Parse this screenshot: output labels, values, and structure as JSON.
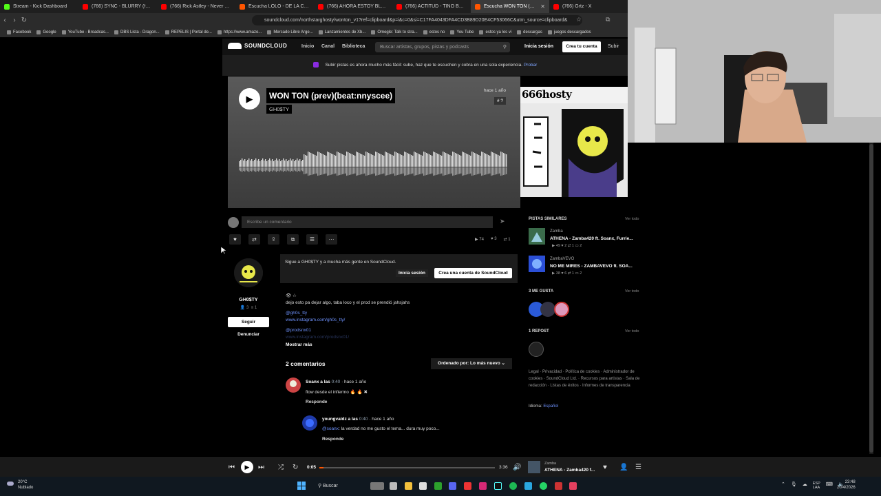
{
  "browser": {
    "tabs": [
      {
        "label": "Stream - Kick Dashboard",
        "color": "#53fc18"
      },
      {
        "label": "(766) SYNC - BLURRY (feat Duki) - Yo",
        "color": "#ff0000"
      },
      {
        "label": "(766) Rick Astley - Never Gonna Give",
        "color": "#ff0000"
      },
      {
        "label": "Escucha LOLO - DE LA CAMA AL CU",
        "color": "#ff5500"
      },
      {
        "label": "(766) AHORA ESTOY BLESS - YouTub",
        "color": "#ff0000"
      },
      {
        "label": "(766) ACTITUD - TINO BG - YouTube",
        "color": "#ff0000"
      },
      {
        "label": "Escucha WON TON (prev)(beat:n",
        "color": "#ff5500"
      },
      {
        "label": "(766) Grtz - X ",
        "color": "#ff0000"
      }
    ],
    "url": "soundcloud.com/northstarghosty/wonton_v1?ref=clipboard&p=i&c=0&si=C17FA4043DFA4CD3B89D20E4CF53066C&utm_source=clipboard&",
    "bookmarks": [
      "Facebook",
      "Google",
      "YouTube - Broadcas...",
      "DBS Lista - Dragon...",
      "REPELIS | Portal de...",
      "https://www.amazo...",
      "Mercado Libre Arge...",
      "Lanzamientos de Xb...",
      "Omegle: Talk to stra...",
      "estos no",
      "You Tube",
      "estos ya los vi",
      "descargas",
      "juegos descargados"
    ]
  },
  "header": {
    "logo": "SOUNDCLOUD",
    "nav": [
      "Inicio",
      "Canal",
      "Biblioteca"
    ],
    "search_placeholder": "Buscar artistas, grupos, pistas y podcasts",
    "login": "Inicia sesión",
    "signup": "Crea tu cuenta",
    "upload": "Subir"
  },
  "banner": {
    "text": "Subir pistas es ahora mucho más fácil: sube, haz que te escuchen y cobra en una sola experiencia.",
    "link": "Probar"
  },
  "track": {
    "title": "WON TON (prev)(beat:nnyscee)",
    "artist": "GH0$TY",
    "posted": "hace 1 año",
    "tag": "# ?",
    "artwork_text": "666hosty"
  },
  "comment_input": {
    "placeholder": "Escribe un comentario"
  },
  "stats": {
    "plays": "74",
    "likes": "3",
    "reposts": "1"
  },
  "artist_panel": {
    "name": "GH0$TY",
    "followers": "3",
    "tracks": "1",
    "follow": "Seguir",
    "report": "Denunciar"
  },
  "follow_card": {
    "text": "Sigue a GH0$TY y a mucha más gente en SoundCloud.",
    "login": "Inicia sesión",
    "signup": "Crea una cuenta de SoundCloud"
  },
  "description": {
    "line0": "👁 ☆",
    "line1": "dejo esto pa dejar algo, taba loco y el prod se prendió jahsjahs",
    "mention1": "@gh0s_tty",
    "link1": "www.instagram.com/gh0s_tty/",
    "mention2": "@prodsnx01",
    "link2": "www.instagram.com/prodsnx01/",
    "show_more": "Mostrar más"
  },
  "comments": {
    "count_label": "2 comentarios",
    "sort_label": "Ordenado por: Lo más nuevo",
    "items": [
      {
        "user": "Soanx a las",
        "ts": "0:40",
        "ago": "· hace 1 año",
        "text": "flow desde el infiermo 🔥 🔥 ✖",
        "reply": "Responde"
      },
      {
        "user": "youngvaldz a las",
        "ts": "0:40",
        "ago": "· hace 1 año",
        "mention": "@soanx",
        "text": ": la verdad no me gusto el tema... dura muy poco...",
        "reply": "Responde"
      }
    ]
  },
  "sidebar": {
    "similar_title": "PISTAS SIMILARES",
    "view_all": "Ver todo",
    "similar": [
      {
        "artist": "Zamba",
        "title": "ATHENA - Zamba420 ft. Soanx, Furrie...",
        "stats": "▶ 49  ♥ 2  ⇄ 1  ▭ 2"
      },
      {
        "artist": "ZambaVEVO",
        "title": "NO ME MIRES - ZAMBAVEVO ft. SOA...",
        "stats": "▶ 38  ♥ 6  ⇄ 1  ▭ 2"
      }
    ],
    "likes_title": "3 ME GUSTA",
    "reposts_title": "1 REPOST",
    "footer": "Legal · Privacidad · Política de cookies · Administrador de cookies · SoundCloud Ltd. · Recursos para artistas · Sala de redacción · Listas de éxitos · Informes de transparencia",
    "language_label": "Idioma:",
    "language": "Español"
  },
  "player": {
    "current": "0:05",
    "duration": "3:36",
    "progress": 0.023,
    "artist": "Zamba",
    "title": "ATHENA - Zamba420 f..."
  },
  "taskbar": {
    "temp": "20°C",
    "weather": "Nublado",
    "search": "Buscar",
    "lang1": "ESP",
    "lang2": "LAA",
    "time": "23:48",
    "date": "20/4/2026"
  }
}
